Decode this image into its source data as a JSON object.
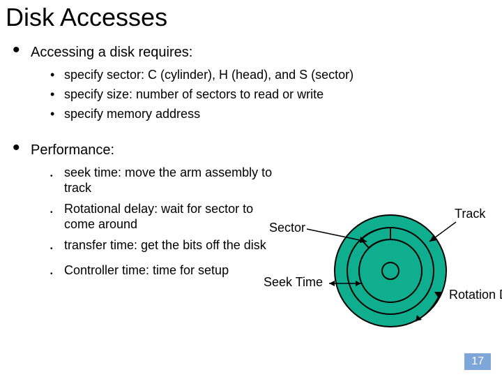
{
  "title": "Disk Accesses",
  "section1": {
    "heading": "Accessing a disk requires:",
    "items": [
      "specify sector: C (cylinder), H (head), and S (sector)",
      "specify size: number of sectors to read or write",
      "specify memory address"
    ]
  },
  "section2": {
    "heading": "Performance:",
    "items": [
      "seek time: move the arm assembly to track",
      "Rotational delay: wait for sector to come around",
      "transfer time: get the bits off the disk",
      "Controller time: time for setup"
    ]
  },
  "diagram": {
    "labels": {
      "track": "Track",
      "sector": "Sector",
      "seek_time": "Seek Time",
      "rotation_delay": "Rotation Delay"
    },
    "colors": {
      "disk_fill": "#0fae8e",
      "disk_stroke": "#000000",
      "sector_fill": "#0fae8e"
    }
  },
  "page_number": "17"
}
